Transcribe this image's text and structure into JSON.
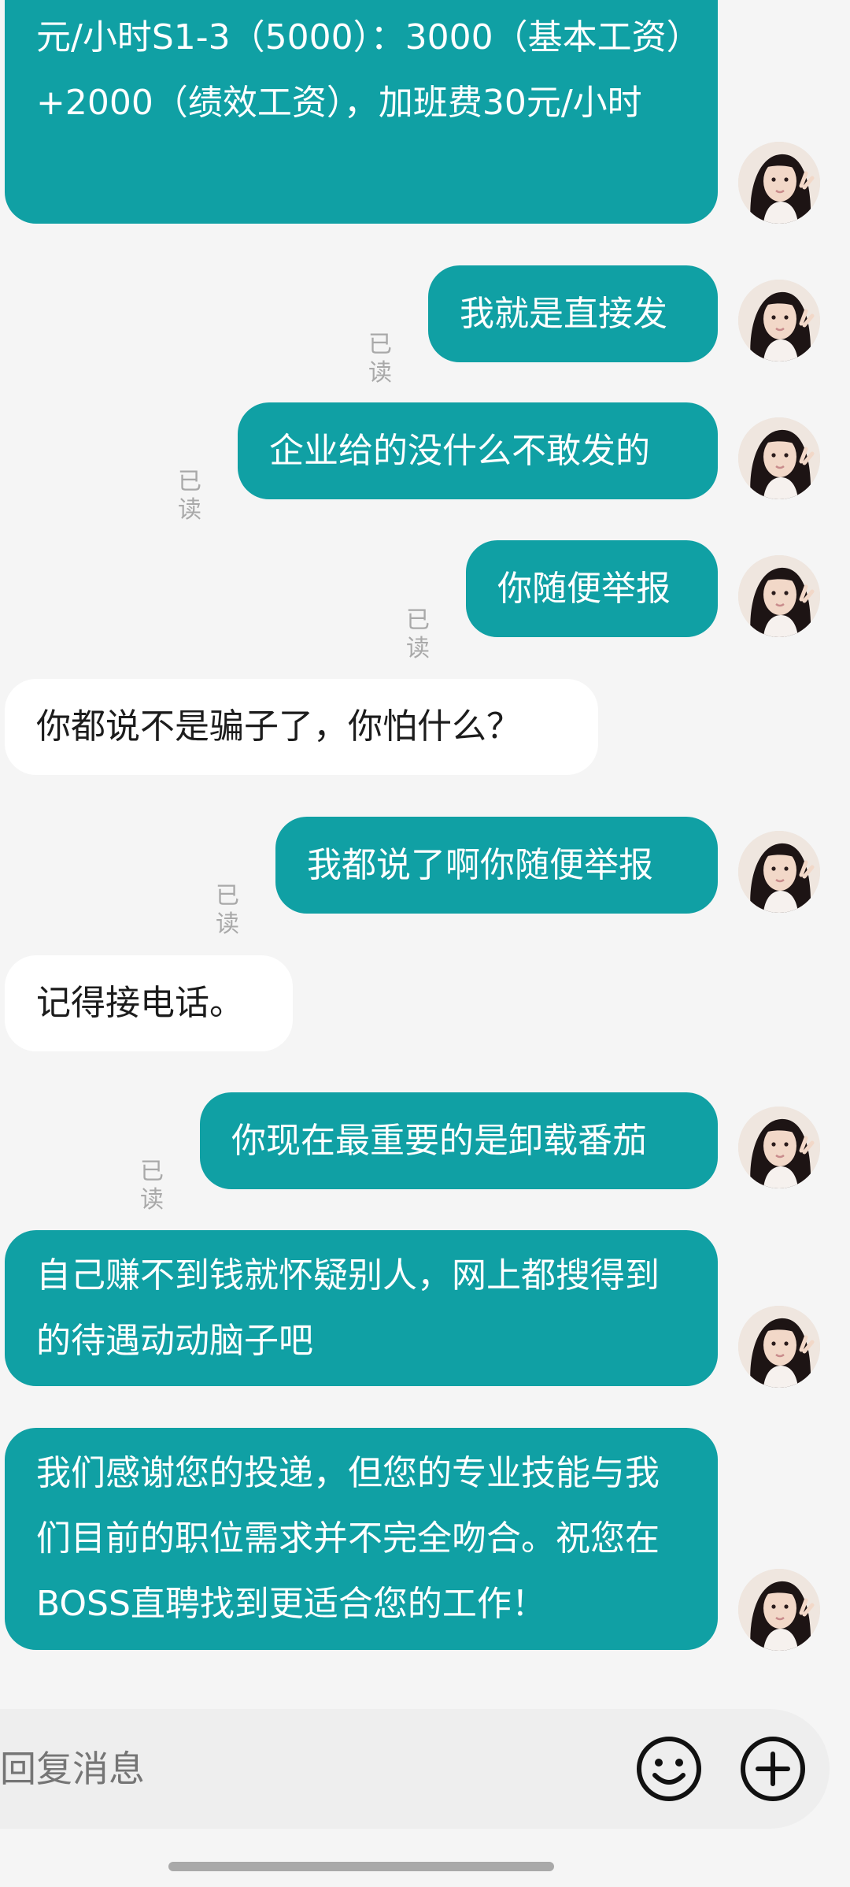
{
  "messages": [
    {
      "id": 0,
      "side": "sent",
      "text": "元/小时S1-3（5000）：3000（基本工资）+2000（绩效工资），加班费30元/小时",
      "read": ""
    },
    {
      "id": 1,
      "side": "sent",
      "text": "我就是直接发",
      "read": "已读"
    },
    {
      "id": 2,
      "side": "sent",
      "text": "企业给的没什么不敢发的",
      "read": "已读"
    },
    {
      "id": 3,
      "side": "sent",
      "text": "你随便举报",
      "read": "已读"
    },
    {
      "id": 4,
      "side": "received",
      "text": "你都说不是骗子了，你怕什么？",
      "read": ""
    },
    {
      "id": 5,
      "side": "sent",
      "text": "我都说了啊你随便举报",
      "read": "已读"
    },
    {
      "id": 6,
      "side": "received",
      "text": "记得接电话。",
      "read": ""
    },
    {
      "id": 7,
      "side": "sent",
      "text": "你现在最重要的是卸载番茄",
      "read": "已读"
    },
    {
      "id": 8,
      "side": "sent",
      "text": "自己赚不到钱就怀疑别人，网上都搜得到的待遇动动脑子吧",
      "read": ""
    },
    {
      "id": 9,
      "side": "sent",
      "text": "我们感谢您的投递，但您的专业技能与我们目前的职位需求并不完全吻合。祝您在BOSS直聘找到更适合您的工作！",
      "read": ""
    }
  ],
  "input": {
    "placeholder": "回复消息"
  },
  "icons": {
    "emoji": "smiley-face-icon",
    "add": "plus-circle-icon"
  },
  "colors": {
    "sent_bubble": "#10a0a4",
    "received_bubble": "#ffffff",
    "background": "#f5f5f5"
  }
}
